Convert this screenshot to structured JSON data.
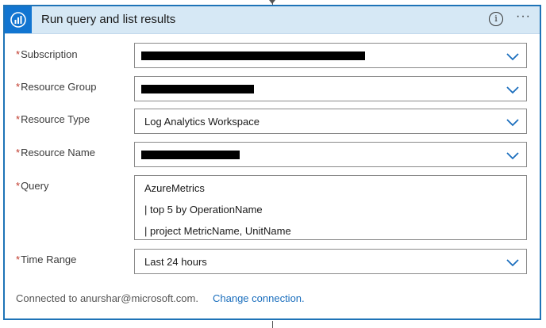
{
  "header": {
    "title": "Run query and list results",
    "info_glyph": "i",
    "more_glyph": "···",
    "icon": "azure-monitor-logs-icon",
    "accent_color": "#1e73b7",
    "header_bg": "#d6e8f5"
  },
  "fields": {
    "subscription": {
      "label": "Subscription",
      "required_mark": "*",
      "value": "",
      "redacted": true
    },
    "resource_group": {
      "label": "Resource Group",
      "required_mark": "*",
      "value": "",
      "redacted": true
    },
    "resource_type": {
      "label": "Resource Type",
      "required_mark": "*",
      "value": "Log Analytics Workspace"
    },
    "resource_name": {
      "label": "Resource Name",
      "required_mark": "*",
      "value": "",
      "redacted": true
    },
    "query": {
      "label": "Query",
      "required_mark": "*",
      "lines": [
        "AzureMetrics",
        "| top 5 by OperationName",
        "| project MetricName, UnitName"
      ]
    },
    "time_range": {
      "label": "Time Range",
      "required_mark": "*",
      "value": "Last 24 hours"
    }
  },
  "footer": {
    "connected_text": "Connected to anurshar@microsoft.com.",
    "change_connection_label": "Change connection."
  },
  "colors": {
    "required": "#c0392b",
    "link": "#1a6ebd",
    "chevron": "#1a6ebd"
  }
}
